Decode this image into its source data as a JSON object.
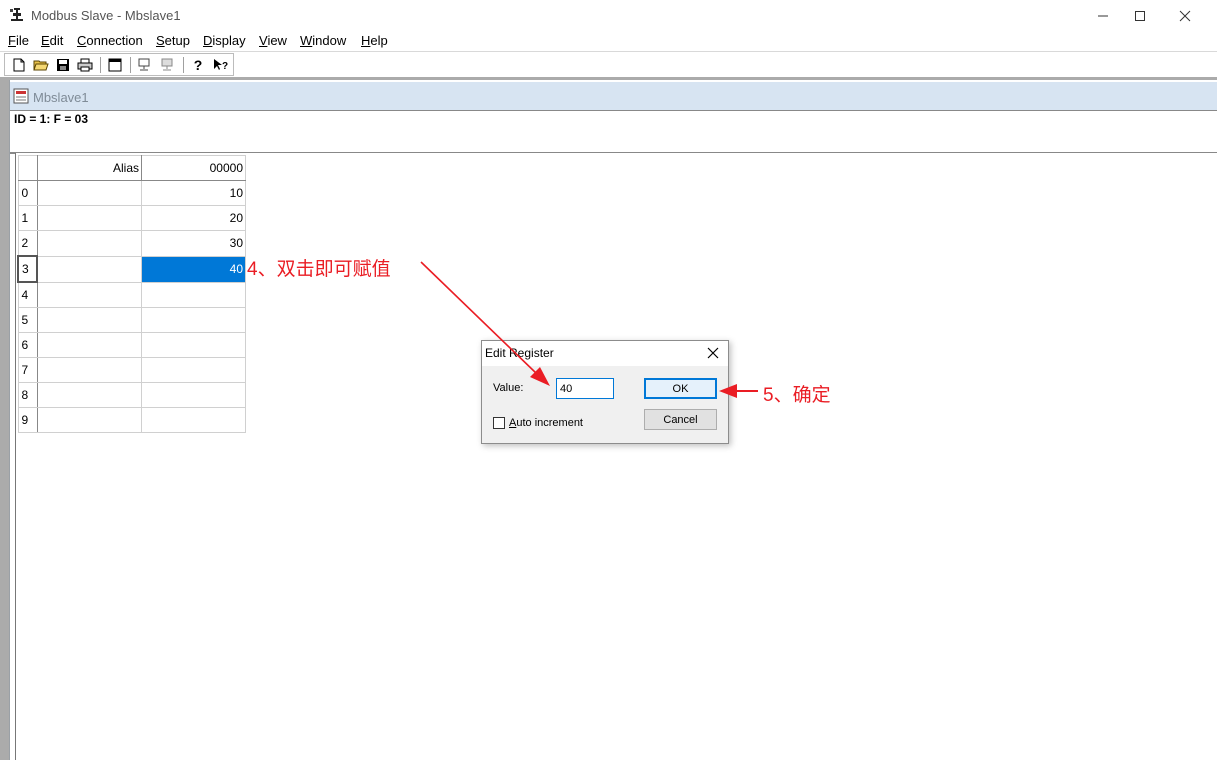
{
  "window": {
    "title": "Modbus Slave - Mbslave1"
  },
  "menu": [
    "File",
    "Edit",
    "Connection",
    "Setup",
    "Display",
    "View",
    "Window",
    "Help"
  ],
  "toolbar": {
    "icons": [
      "new-file-icon",
      "open-folder-icon",
      "save-icon",
      "print-icon",
      "window-icon",
      "connect-icon",
      "disconnect-icon",
      "help-icon",
      "context-help-icon"
    ]
  },
  "child": {
    "title": "Mbslave1",
    "info": "ID = 1: F = 03"
  },
  "grid": {
    "headers": {
      "alias": "Alias",
      "address": "00000"
    },
    "rows": [
      {
        "index": "0",
        "alias": "",
        "value": "10"
      },
      {
        "index": "1",
        "alias": "",
        "value": "20"
      },
      {
        "index": "2",
        "alias": "",
        "value": "30"
      },
      {
        "index": "3",
        "alias": "",
        "value": "40"
      },
      {
        "index": "4",
        "alias": "",
        "value": ""
      },
      {
        "index": "5",
        "alias": "",
        "value": ""
      },
      {
        "index": "6",
        "alias": "",
        "value": ""
      },
      {
        "index": "7",
        "alias": "",
        "value": ""
      },
      {
        "index": "8",
        "alias": "",
        "value": ""
      },
      {
        "index": "9",
        "alias": "",
        "value": ""
      }
    ],
    "selected_row": 3
  },
  "annotations": {
    "step4": "4、双击即可赋值",
    "step5": "5、确定",
    "color": "#ea1d24"
  },
  "dialog": {
    "title": "Edit Register",
    "value_label": "Value:",
    "value": "40",
    "ok_label": "OK",
    "cancel_label": "Cancel",
    "auto_increment_label": "Auto increment",
    "auto_increment_checked": false
  },
  "colors": {
    "selection": "#0078d7",
    "child_title_bg": "#d7e4f2",
    "mdi_bg": "#ababab"
  }
}
